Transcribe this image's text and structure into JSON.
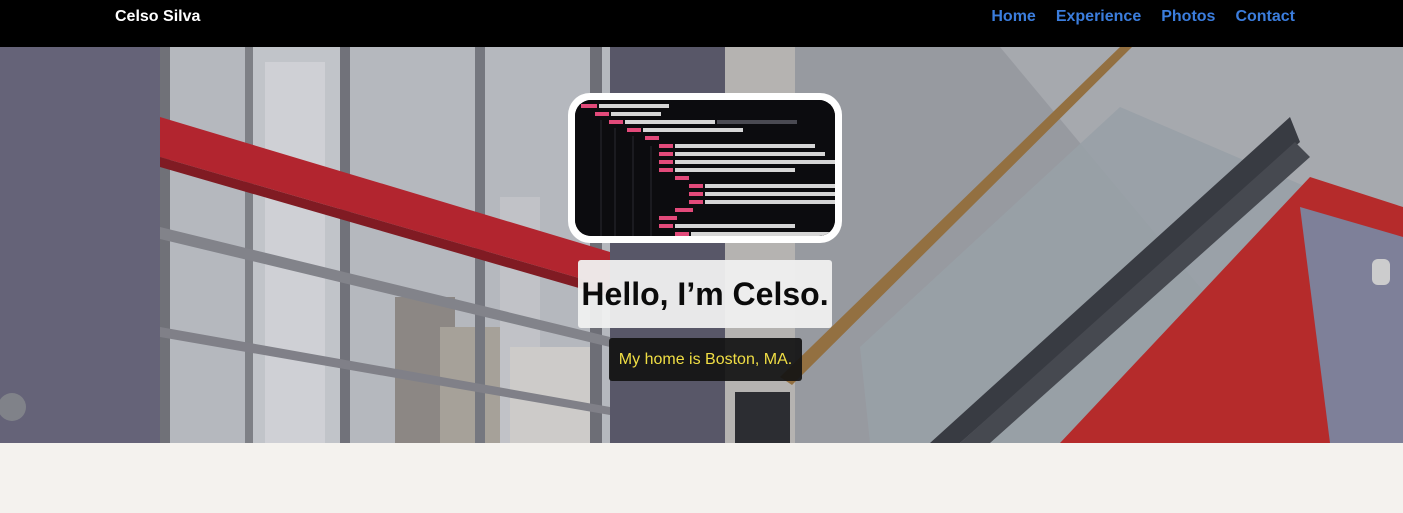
{
  "navbar": {
    "brand": "Celso Silva",
    "links": [
      {
        "label": "Home"
      },
      {
        "label": "Experience"
      },
      {
        "label": "Photos"
      },
      {
        "label": "Contact"
      }
    ],
    "link_color": "#3b7ddd",
    "background": "#000000"
  },
  "hero": {
    "headline": "Hello, I’m Celso.",
    "subline": "My home is Boston, MA.",
    "subline_color": "#f0de44",
    "profile_image": "code-screenshot-image",
    "background_image": "loft-staircase-photo"
  },
  "page": {
    "background": "#f4f2ee"
  }
}
